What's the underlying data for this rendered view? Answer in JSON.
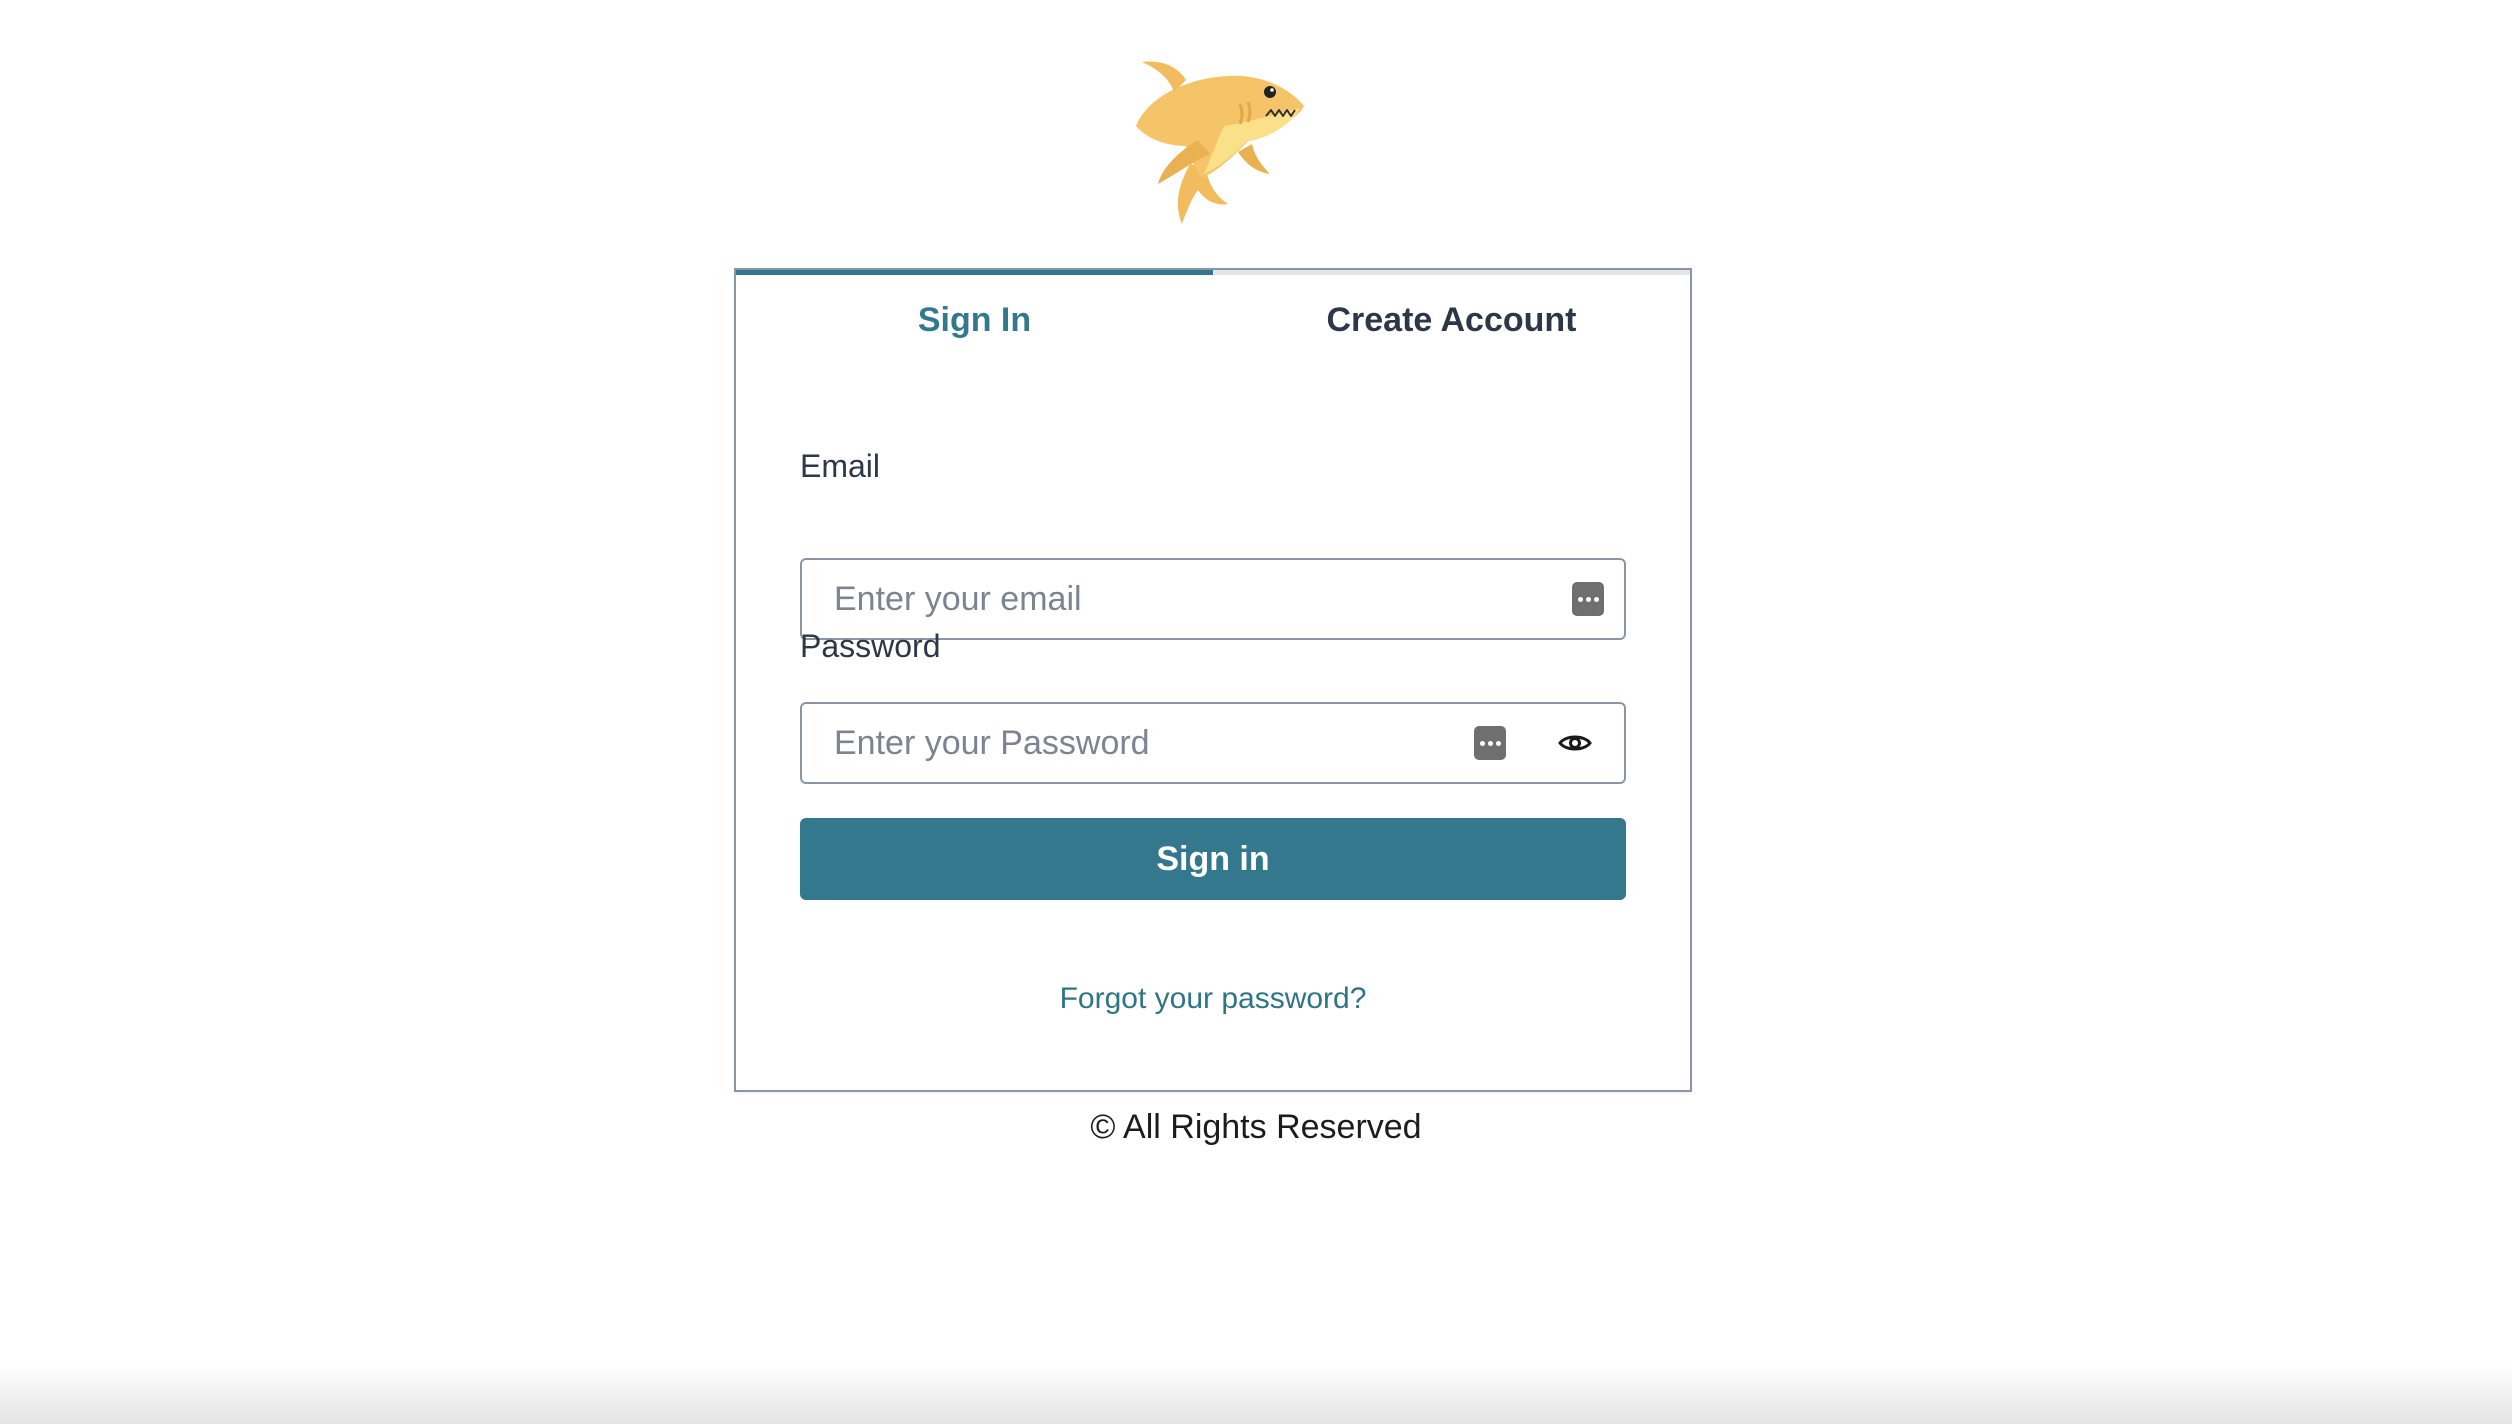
{
  "logo": {
    "icon": "shark-logo-icon",
    "color": "#f5c468"
  },
  "tabs": [
    {
      "label": "Sign In",
      "active": true
    },
    {
      "label": "Create Account",
      "active": false
    }
  ],
  "form": {
    "email_label": "Email",
    "email_placeholder": "Enter your email",
    "email_value": "",
    "password_label": "Password",
    "password_placeholder": "Enter your Password",
    "password_value": "",
    "show_password_icon": "eye-icon",
    "submit_label": "Sign in",
    "forgot_link": "Forgot your password?"
  },
  "footer": {
    "text": "© All Rights Reserved"
  },
  "colors": {
    "accent": "#33788d",
    "border": "#8a96a3",
    "text": "#2d3748"
  }
}
